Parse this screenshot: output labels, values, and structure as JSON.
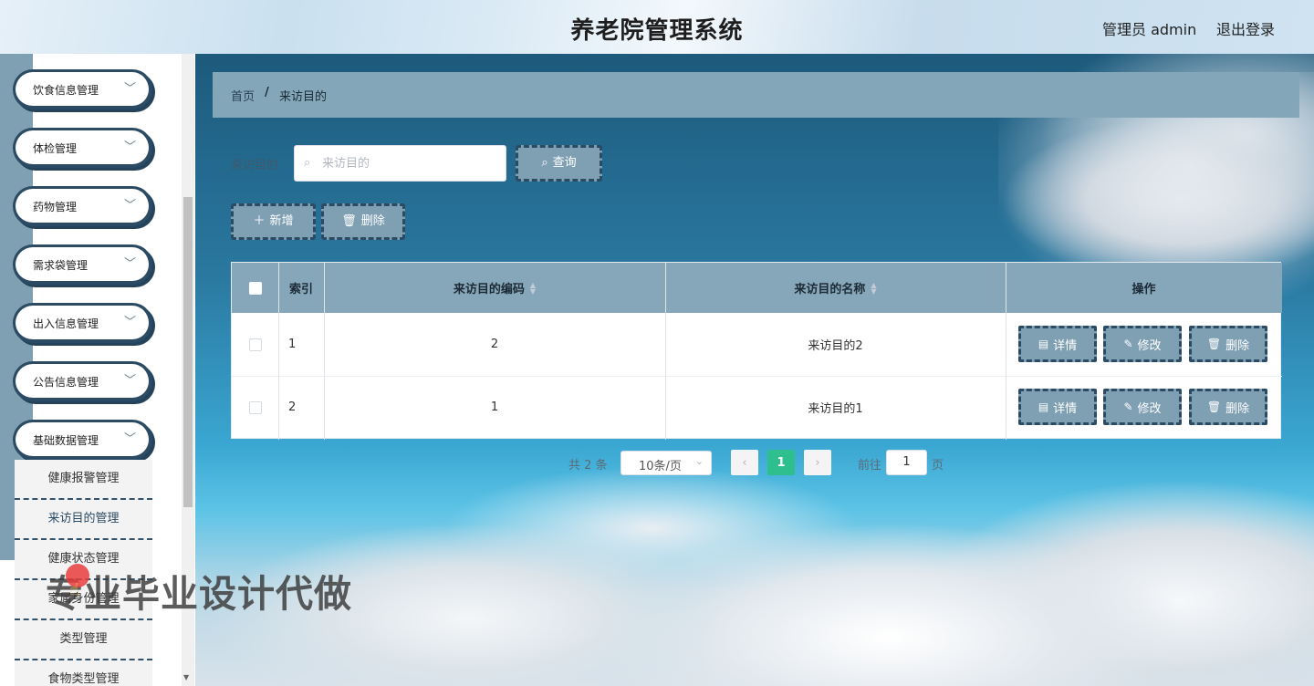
{
  "header": {
    "title": "养老院管理系统",
    "user": "管理员 admin",
    "logout": "退出登录"
  },
  "sidebar": {
    "menus": [
      {
        "label": "饮食信息管理"
      },
      {
        "label": "体检管理"
      },
      {
        "label": "药物管理"
      },
      {
        "label": "需求袋管理"
      },
      {
        "label": "出入信息管理"
      },
      {
        "label": "公告信息管理"
      },
      {
        "label": "基础数据管理"
      }
    ],
    "submenus": [
      {
        "label": "健康报警管理"
      },
      {
        "label": "来访目的管理"
      },
      {
        "label": "健康状态管理"
      },
      {
        "label": "家属身份管理"
      },
      {
        "label": "类型管理"
      },
      {
        "label": "食物类型管理"
      }
    ]
  },
  "breadcrumb": {
    "home": "首页",
    "separator": "/",
    "current": "来访目的"
  },
  "search": {
    "label": "来访目的",
    "placeholder": "来访目的",
    "value": "",
    "button": "查询"
  },
  "toolbar": {
    "add": "新增",
    "delete": "删除"
  },
  "table": {
    "columns": {
      "index": "索引",
      "code": "来访目的编码",
      "name": "来访目的名称",
      "actions": "操作"
    },
    "rows": [
      {
        "index": "1",
        "code": "2",
        "name": "来访目的2"
      },
      {
        "index": "2",
        "code": "1",
        "name": "来访目的1"
      }
    ],
    "actions": {
      "detail": "详情",
      "edit": "修改",
      "delete": "删除"
    }
  },
  "pagination": {
    "total": "共 2 条",
    "page_size": "10条/页",
    "current_page": "1",
    "goto": "前往",
    "goto_value": "1",
    "page_suffix": "页"
  },
  "watermark": "专业毕业设计代做",
  "colors": {
    "accent": "#7f9fb3",
    "border_dark": "#2b4a63",
    "header_row": "#86a7ba",
    "active_page": "#2fbf8f"
  }
}
